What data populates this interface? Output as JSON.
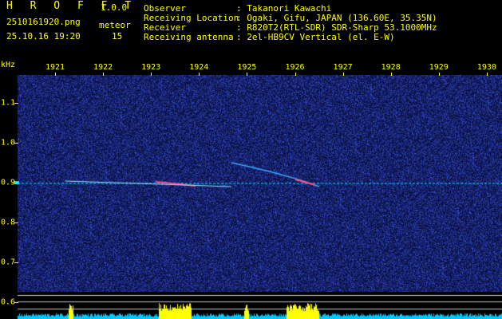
{
  "app": {
    "name": "H R O F F T",
    "version": "1.0.0"
  },
  "file": {
    "filename": "2510161920.png",
    "datetime": "25.10.16 19:20"
  },
  "meteor": {
    "label": "meteor",
    "count": "15"
  },
  "info": {
    "observer_label": "Observer",
    "observer_value": ": Takanori Kawachi",
    "location_label": "Receiving Location",
    "location_value": ": Ogaki, Gifu, JAPAN (136.60E, 35.35N)",
    "receiver_label": "Receiver",
    "receiver_value": ": R820T2(RTL-SDR) SDR-Sharp 53.1000MHz",
    "antenna_label": "Receiving antenna",
    "antenna_value": ": 2el-HB9CV Vertical (el. E-W)"
  },
  "y_axis": {
    "unit": "kHz",
    "ticks": [
      "1.1",
      "1.0",
      "0.9",
      "0.8",
      "0.7",
      "0.6"
    ]
  },
  "x_axis": {
    "ticks": [
      "1921",
      "1922",
      "1923",
      "1924",
      "1925",
      "1926",
      "1927",
      "1928",
      "1929",
      "1930"
    ]
  },
  "colors": {
    "text": "#ffff00",
    "background": "#000000",
    "carrier": "#00e0ff",
    "noise": "#1c2a88",
    "power_fill": "#00c8ff",
    "power_burst": "#ffff00"
  }
}
